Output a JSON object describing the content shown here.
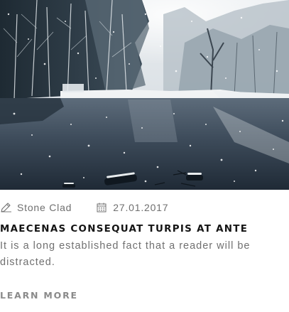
{
  "post": {
    "image": {
      "subject": "snowy winter lake with bare trees"
    },
    "author": {
      "icon": "pencil-icon",
      "name": "Stone Clad"
    },
    "date": {
      "icon": "calendar-icon",
      "value": "27.01.2017"
    },
    "title": "MAECENAS CONSEQUAT TURPIS AT ANTE",
    "excerpt": "It is a long established fact that a reader will be distracted.",
    "cta_label": "LEARN MORE"
  },
  "colors": {
    "title": "#141414",
    "meta": "#6f6f6f",
    "excerpt": "#707070",
    "cta": "#8a8a8a",
    "background": "#ffffff"
  }
}
